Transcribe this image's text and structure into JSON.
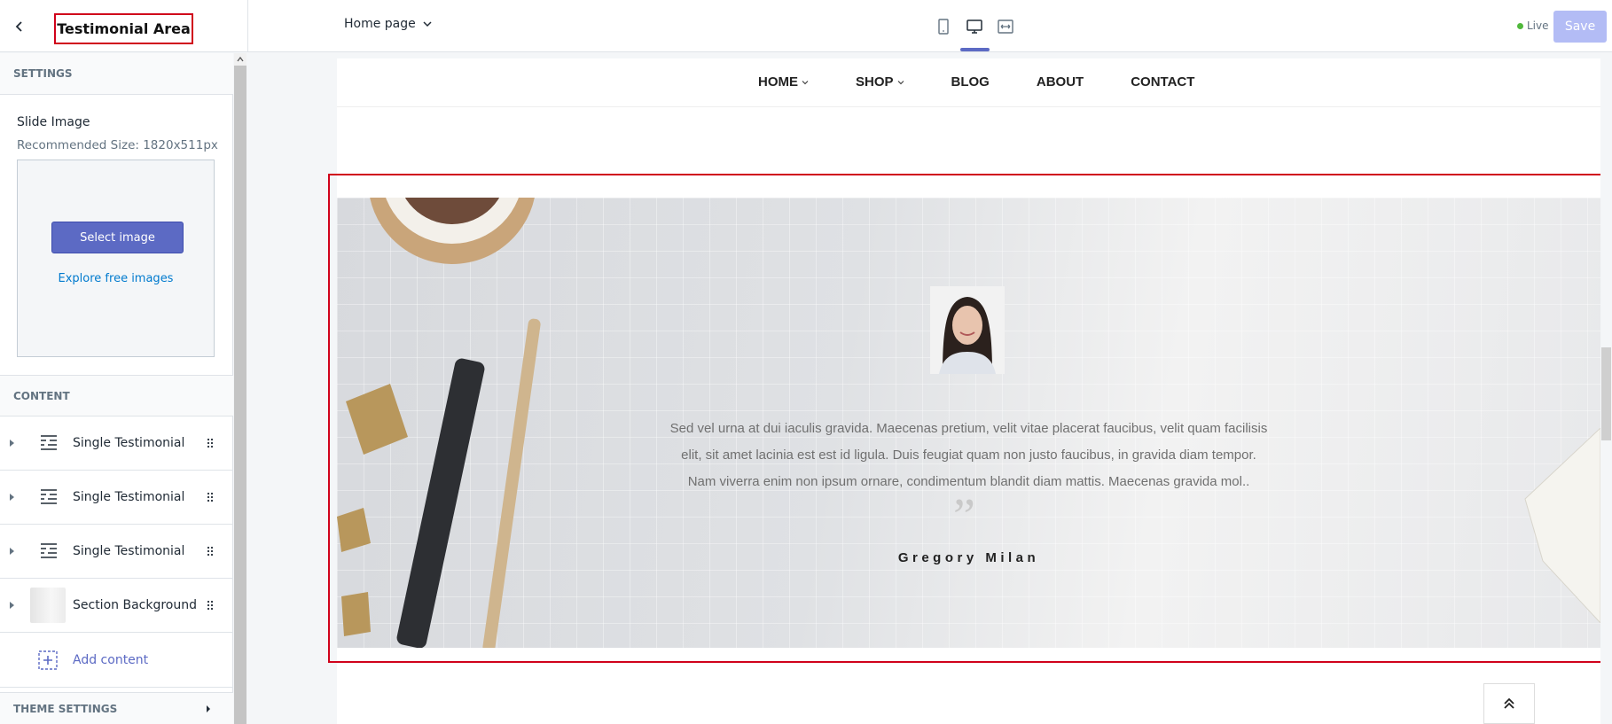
{
  "header": {
    "title": "Testimonial Area",
    "page_select": "Home page",
    "live_label": "Live",
    "save_label": "Save"
  },
  "sidebar": {
    "settings_heading": "SETTINGS",
    "slide_image_label": "Slide Image",
    "recommended_size": "Recommended Size: 1820x511px",
    "select_image_label": "Select image",
    "explore_label": "Explore free images",
    "content_heading": "CONTENT",
    "blocks": [
      {
        "label": "Single Testimonial",
        "icon": "testimonial-icon"
      },
      {
        "label": "Single Testimonial",
        "icon": "testimonial-icon"
      },
      {
        "label": "Single Testimonial",
        "icon": "testimonial-icon"
      },
      {
        "label": "Section Background",
        "icon": "background-thumbnail"
      }
    ],
    "add_content_label": "Add content",
    "theme_settings_heading": "THEME SETTINGS"
  },
  "preview": {
    "nav": [
      "HOME",
      "SHOP",
      "BLOG",
      "ABOUT",
      "CONTACT"
    ],
    "testimonial_text": "Sed vel urna at dui iaculis gravida. Maecenas pretium, velit vitae placerat faucibus, velit quam facilisis elit, sit amet lacinia est est id ligula. Duis feugiat quam non justo faucibus, in gravida diam tempor. Nam viverra enim non ipsum ornare, condimentum blandit diam mattis. Maecenas gravida mol..",
    "quote_mark": "”",
    "author": "Gregory Milan"
  },
  "colors": {
    "accent": "#5c6ac4",
    "highlight": "#d0021b",
    "live": "#50b83c"
  }
}
